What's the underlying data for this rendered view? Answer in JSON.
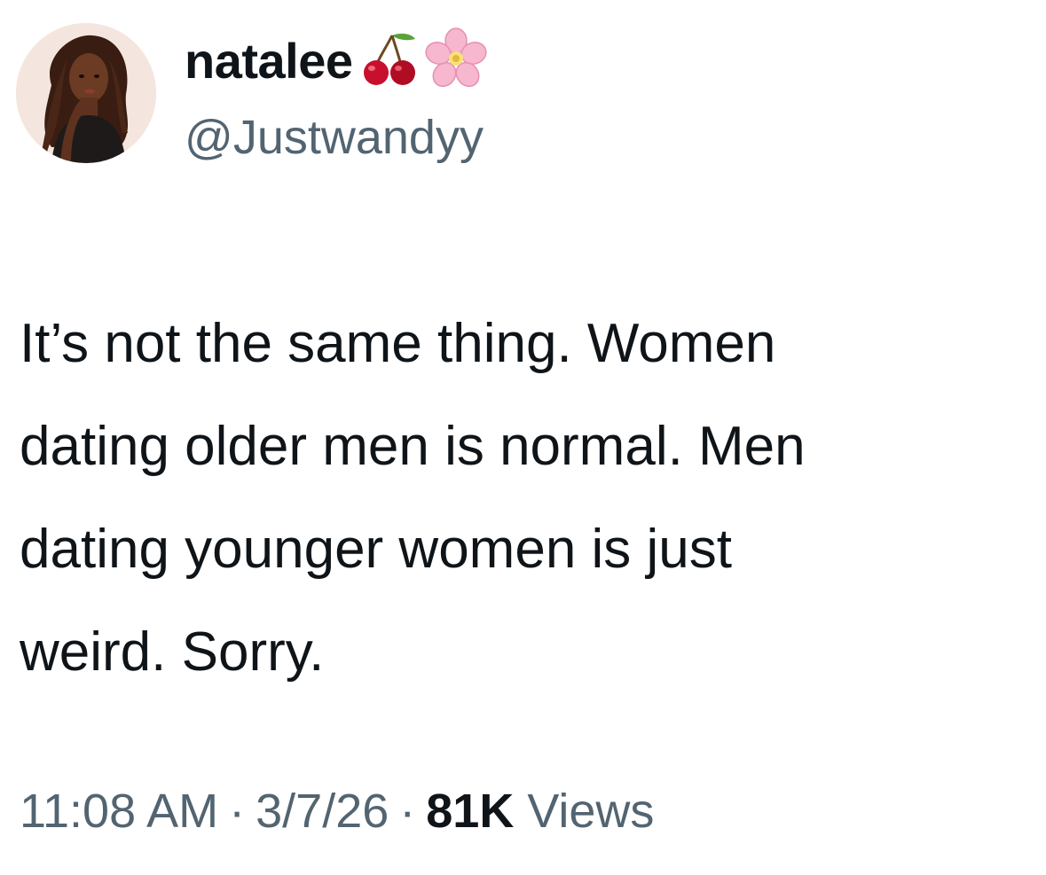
{
  "author": {
    "display_name": "natalee",
    "name_emojis": [
      "cherry-emoji",
      "cherry-blossom-emoji"
    ],
    "handle": "@Justwandyy"
  },
  "tweet": {
    "lines": [
      "It’s not the same thing. Women",
      "dating older men is normal. Men",
      "dating younger women is just",
      "weird. Sorry."
    ]
  },
  "meta": {
    "time": "11:08 AM",
    "separator": "·",
    "date": "3/7/26",
    "views_count": "81K",
    "views_label": "Views"
  },
  "colors": {
    "text_primary": "#0f1419",
    "text_secondary": "#536471",
    "background": "#ffffff"
  }
}
